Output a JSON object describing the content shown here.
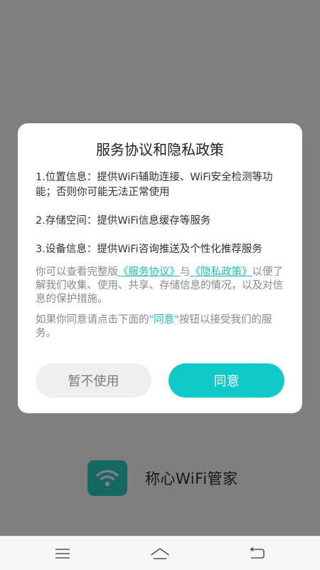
{
  "app": {
    "name": "称心WiFi管家",
    "accent_color": "#10c9c9",
    "logo_icon": "wifi-icon"
  },
  "dialog": {
    "title": "服务协议和隐私政策",
    "clauses": [
      "1.位置信息：提供WiFi辅助连接、WiFi安全检测等功能；否则你可能无法正常使用",
      "2.存储空间：提供WiFi信息缓存等服务",
      "3.设备信息：提供WiFi咨询推送及个性化推荐服务"
    ],
    "notice": {
      "prefix": "你可以查看完整版",
      "service_link": "《服务协议》",
      "and": "与",
      "privacy_link": "《隐私政策》",
      "suffix": "以便了解我们收集、使用、共享、存储信息的情况，以及对信息的保护措施。"
    },
    "consent": {
      "prefix": "如果你同意请点击下面的",
      "highlight": "\"同意\"",
      "suffix": "按钮以接受我们的服务。"
    },
    "decline_label": "暂不使用",
    "agree_label": "同意"
  },
  "navbar": {
    "menu_icon": "menu-icon",
    "home_icon": "home-icon",
    "back_icon": "back-icon"
  }
}
